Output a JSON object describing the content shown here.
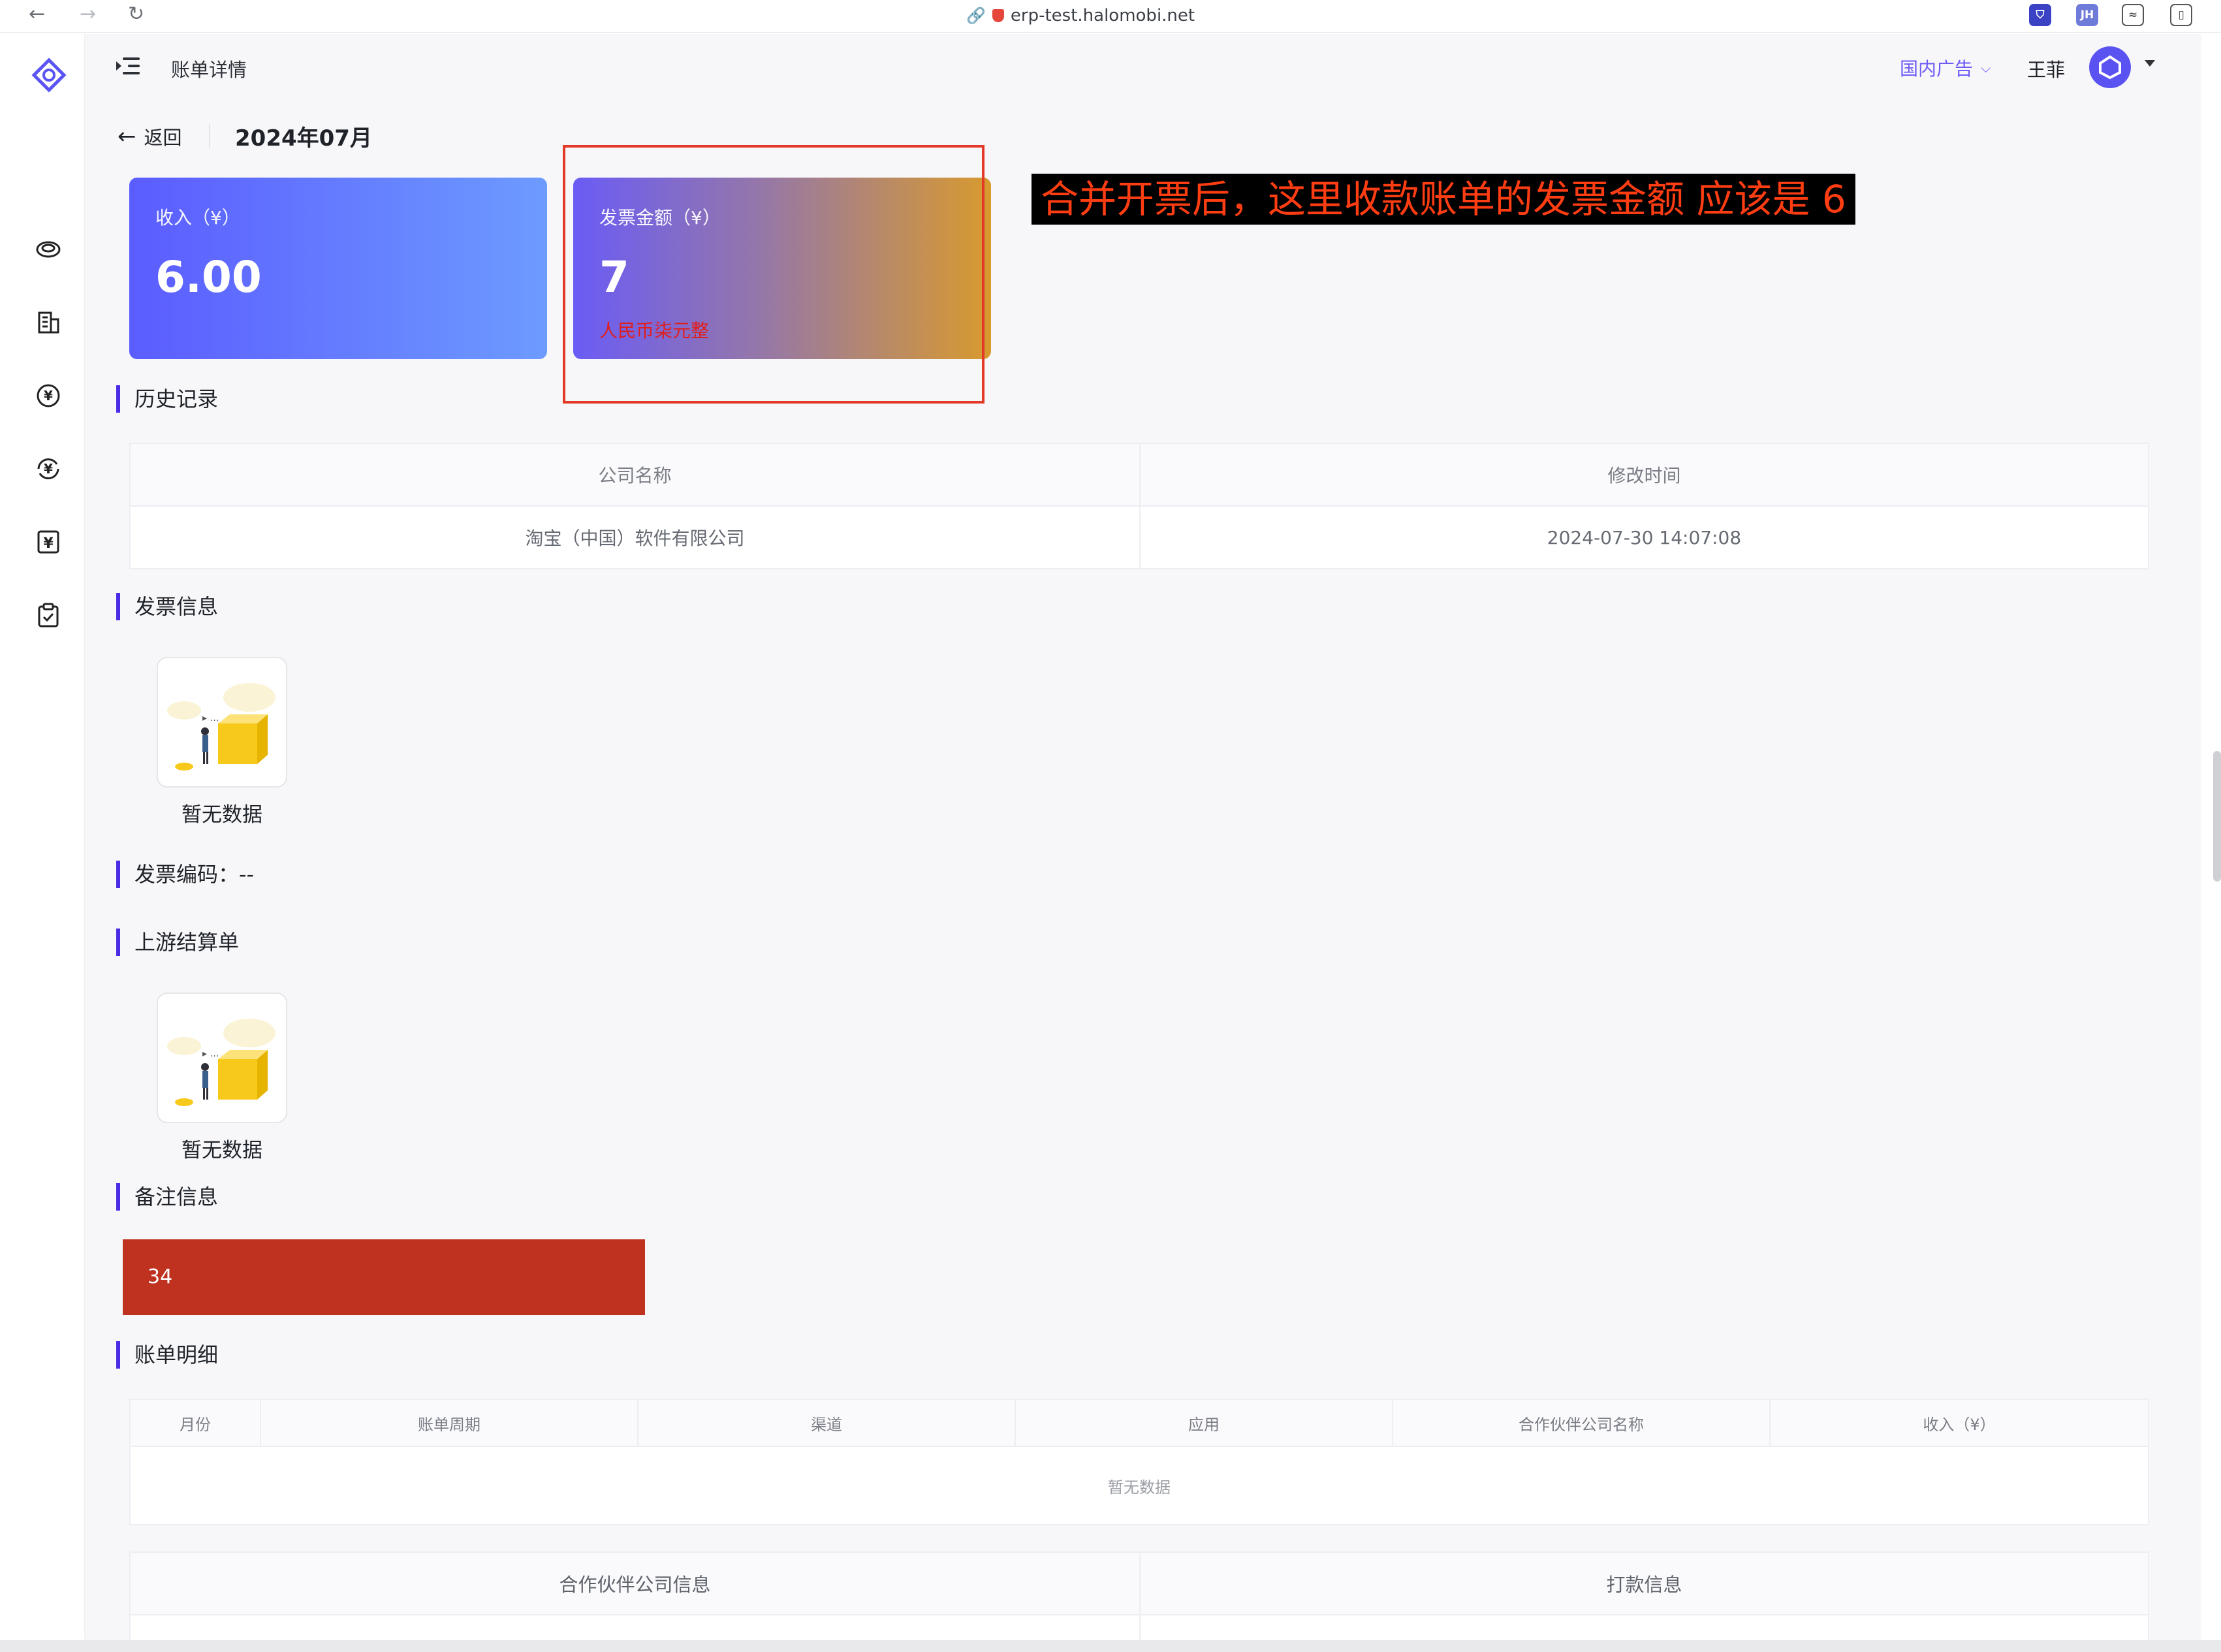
{
  "browser": {
    "url": "erp-test.halomobi.net",
    "ext1": "JH"
  },
  "topbar": {
    "breadcrumb": "账单详情",
    "tenant": "国内广告",
    "user": "王菲"
  },
  "header": {
    "back_label": "返回",
    "period": "2024年07月"
  },
  "cards": {
    "income_label": "收入（¥）",
    "income_value": "6.00",
    "invoice_label": "发票金额（¥）",
    "invoice_value": "7",
    "invoice_words": "人民币柒元整"
  },
  "annotation": "合并开票后，这里收款账单的发票金额 应该是 6",
  "history": {
    "title": "历史记录",
    "columns": [
      "公司名称",
      "修改时间"
    ],
    "rows": [
      [
        "淘宝（中国）软件有限公司",
        "2024-07-30 14:07:08"
      ]
    ]
  },
  "invoice_info": {
    "title": "发票信息",
    "empty_text": "暂无数据"
  },
  "invoice_code": {
    "label": "发票编码：--"
  },
  "upstream": {
    "title": "上游结算单",
    "empty_text": "暂无数据"
  },
  "remark": {
    "title": "备注信息",
    "value": "34"
  },
  "details": {
    "title": "账单明细",
    "columns": [
      "月份",
      "账单周期",
      "渠道",
      "应用",
      "合作伙伴公司名称",
      "收入（¥）"
    ],
    "empty_text": "暂无数据"
  },
  "bottom_table": {
    "columns": [
      "合作伙伴公司信息",
      "打款信息"
    ]
  },
  "colors": {
    "accent": "#4b2ce6",
    "tenant": "#6d5cf6",
    "annotation_text": "#ff3d12",
    "remark_bg": "#bf3220"
  },
  "icons": {
    "sidebar": [
      "logo-icon",
      "coin-stack-icon",
      "building-icon",
      "yuan-refresh-icon",
      "yuan-exchange-icon",
      "yuan-receipt-icon",
      "clipboard-check-icon"
    ]
  }
}
